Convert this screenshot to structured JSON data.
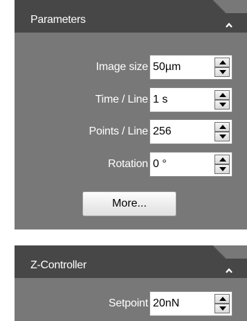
{
  "parameters_panel": {
    "title": "Parameters",
    "fields": [
      {
        "label": "Image size",
        "value": "50µm"
      },
      {
        "label": "Time / Line",
        "value": "1 s"
      },
      {
        "label": "Points / Line",
        "value": "256"
      },
      {
        "label": "Rotation",
        "value": "0 °"
      }
    ],
    "more_label": "More..."
  },
  "z_controller_panel": {
    "title": "Z-Controller",
    "fields": [
      {
        "label": "Setpoint",
        "value": "20nN"
      }
    ]
  },
  "colors": {
    "panel_body": "#787878",
    "panel_header": "#474747",
    "text_light": "#ffffff"
  }
}
